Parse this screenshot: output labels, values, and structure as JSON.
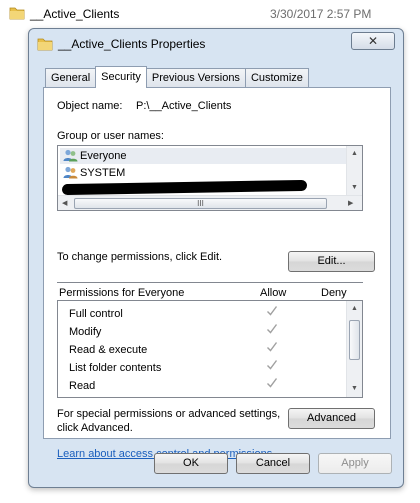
{
  "explorer": {
    "folder_name": "__Active_Clients",
    "date_modified": "3/30/2017 2:57 PM"
  },
  "dialog": {
    "title": "__Active_Clients Properties",
    "close_glyph": "✕",
    "tabs": [
      {
        "label": "General",
        "active": false
      },
      {
        "label": "Security",
        "active": true
      },
      {
        "label": "Previous Versions",
        "active": false
      },
      {
        "label": "Customize",
        "active": false
      }
    ],
    "object_name_label": "Object name:",
    "object_name_value": "P:\\__Active_Clients",
    "group_label": "Group or user names:",
    "users": [
      {
        "name": "Everyone",
        "icon": "user-group-icon",
        "selected": true
      },
      {
        "name": "SYSTEM",
        "icon": "user-group-icon",
        "selected": false
      }
    ],
    "hscroll_grip": "III",
    "change_text": "To change permissions, click Edit.",
    "edit_button": "Edit...",
    "permissions_header": "Permissions for Everyone",
    "allow_header": "Allow",
    "deny_header": "Deny",
    "permissions": [
      {
        "name": "Full control",
        "allow": true,
        "deny": false
      },
      {
        "name": "Modify",
        "allow": true,
        "deny": false
      },
      {
        "name": "Read & execute",
        "allow": true,
        "deny": false
      },
      {
        "name": "List folder contents",
        "allow": true,
        "deny": false
      },
      {
        "name": "Read",
        "allow": true,
        "deny": false
      }
    ],
    "special_text_1": "For special permissions or advanced settings,",
    "special_text_2": "click Advanced.",
    "advanced_button": "Advanced",
    "learn_link": "Learn about access control and permissions",
    "ok_button": "OK",
    "cancel_button": "Cancel",
    "apply_button": "Apply"
  },
  "colors": {
    "dialog_frame": "#d7e4f2",
    "link": "#1b5fbd",
    "check_gray": "#a0a0a0"
  }
}
